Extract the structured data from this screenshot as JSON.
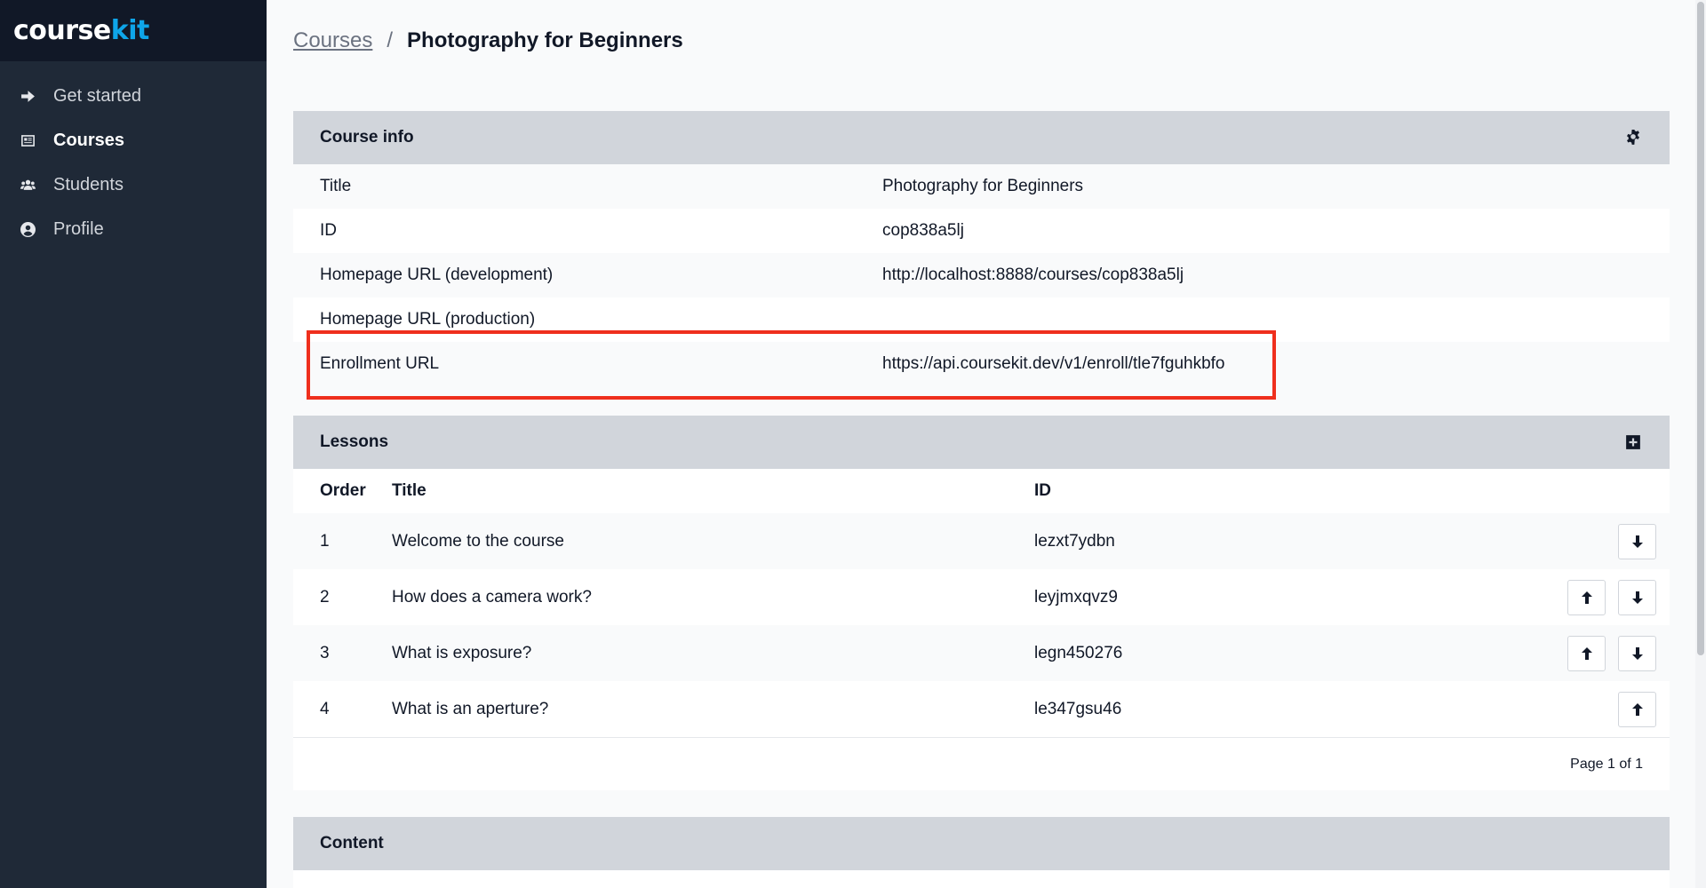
{
  "app": {
    "logo_part1": "course",
    "logo_part2": "kit"
  },
  "sidebar": {
    "items": [
      {
        "label": "Get started",
        "icon": "arrow-right-icon",
        "active": false
      },
      {
        "label": "Courses",
        "icon": "courses-icon",
        "active": true
      },
      {
        "label": "Students",
        "icon": "students-icon",
        "active": false
      },
      {
        "label": "Profile",
        "icon": "profile-icon",
        "active": false
      }
    ]
  },
  "breadcrumb": {
    "parent": "Courses",
    "separator": "/",
    "current": "Photography for Beginners"
  },
  "course_info": {
    "header": "Course info",
    "rows": [
      {
        "label": "Title",
        "value": "Photography for Beginners"
      },
      {
        "label": "ID",
        "value": "cop838a5lj"
      },
      {
        "label": "Homepage URL (development)",
        "value": "http://localhost:8888/courses/cop838a5lj"
      },
      {
        "label": "Homepage URL (production)",
        "value": ""
      },
      {
        "label": "Enrollment URL",
        "value": "https://api.coursekit.dev/v1/enroll/tle7fguhkbfo"
      }
    ]
  },
  "lessons": {
    "header": "Lessons",
    "columns": {
      "order": "Order",
      "title": "Title",
      "id": "ID"
    },
    "rows": [
      {
        "order": "1",
        "title": "Welcome to the course",
        "id": "lezxt7ydbn"
      },
      {
        "order": "2",
        "title": "How does a camera work?",
        "id": "leyjmxqvz9"
      },
      {
        "order": "3",
        "title": "What is exposure?",
        "id": "legn450276"
      },
      {
        "order": "4",
        "title": "What is an aperture?",
        "id": "le347gsu46"
      }
    ],
    "pager": "Page 1 of 1"
  },
  "content": {
    "header": "Content"
  },
  "colors": {
    "highlight": "#ef2f1d",
    "brand_accent": "#0ea5e9",
    "sidebar_bg": "#1f2937"
  }
}
